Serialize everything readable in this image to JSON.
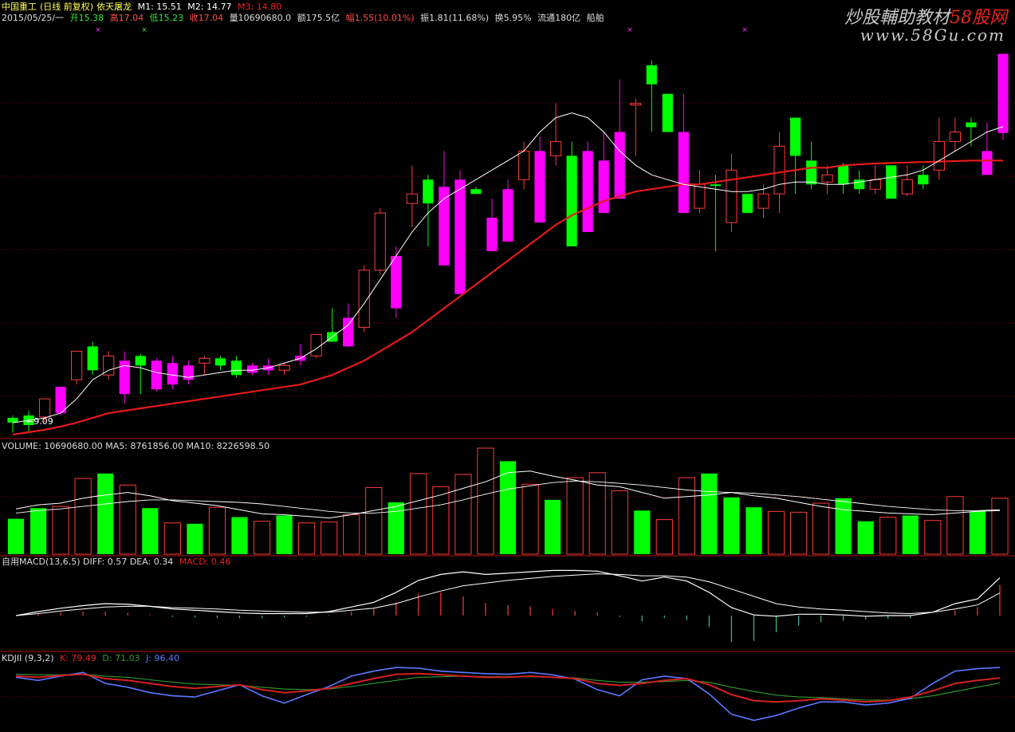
{
  "header": {
    "stock_name": "中国重工",
    "chart_mode": "(日线 前复权)",
    "indicator_name": "依天屠龙",
    "m1_label": "M1: 15.51",
    "m2_label": "M2: 14.77",
    "m3_label": "M3: 14.80",
    "date": "2015/05/25/一",
    "open": "开15.38",
    "high": "高17.04",
    "low": "低15.23",
    "close": "收17.04",
    "volume": "量10690680.0",
    "amount": "额175.5亿",
    "change": "幅1.55(10.01%)",
    "amplitude": "振1.81(11.68%)",
    "turnover": "换5.95%",
    "float_cap": "流通180亿",
    "sector": "船舶"
  },
  "watermark": {
    "line1_a": "炒股輔助教材",
    "line1_b": "58股网",
    "line2": "www.58Gu.com"
  },
  "panels": {
    "price_low_marker": "←9.09",
    "volume_header": "VOLUME: 10690680.00  MA5: 8761856.00  MA10: 8226598.50",
    "macd_header_a": "自用MACD(13,6,5)  DIFF: 0.57  DEA: 0.34",
    "macd_header_b": "MACD: 0.46",
    "kdj_header_a": "KDJII (9,3,2)",
    "kdj_header_b": "K: 79.49",
    "kdj_header_c": "D: 71.03",
    "kdj_header_d": "J: 96.40"
  },
  "colors": {
    "up": "#ff00ff",
    "down": "#00ff00",
    "hollow_up": "#ff3b3b",
    "ma_fast": "#ffffff",
    "ma_slow": "#e41a1a",
    "kdj_k": "#d42020",
    "kdj_d": "#2e9d2e",
    "kdj_j": "#5a78ff",
    "grid": "#7a0d0d"
  },
  "chart_data": {
    "type": "candlestick",
    "price": {
      "ylim": [
        9.0,
        17.5
      ],
      "candles": [
        {
          "o": 9.3,
          "h": 9.45,
          "l": 9.09,
          "c": 9.4,
          "style": "down"
        },
        {
          "o": 9.25,
          "h": 9.55,
          "l": 9.1,
          "c": 9.45,
          "style": "down"
        },
        {
          "o": 9.42,
          "h": 9.55,
          "l": 9.3,
          "c": 9.8,
          "style": "hollow"
        },
        {
          "o": 9.5,
          "h": 10.05,
          "l": 9.45,
          "c": 10.05,
          "style": "up"
        },
        {
          "o": 10.2,
          "h": 10.8,
          "l": 10.1,
          "c": 10.8,
          "style": "hollow"
        },
        {
          "o": 10.4,
          "h": 11.0,
          "l": 10.3,
          "c": 10.9,
          "style": "down"
        },
        {
          "o": 10.3,
          "h": 10.8,
          "l": 10.2,
          "c": 10.7,
          "style": "hollow"
        },
        {
          "o": 10.6,
          "h": 10.8,
          "l": 9.7,
          "c": 9.9,
          "style": "up"
        },
        {
          "o": 10.7,
          "h": 10.75,
          "l": 9.9,
          "c": 10.5,
          "style": "down"
        },
        {
          "o": 10.6,
          "h": 10.65,
          "l": 9.95,
          "c": 10.0,
          "style": "up"
        },
        {
          "o": 10.55,
          "h": 10.7,
          "l": 10.0,
          "c": 10.1,
          "style": "up"
        },
        {
          "o": 10.5,
          "h": 10.6,
          "l": 10.1,
          "c": 10.2,
          "style": "up"
        },
        {
          "o": 10.55,
          "h": 10.7,
          "l": 10.3,
          "c": 10.65,
          "style": "hollow"
        },
        {
          "o": 10.5,
          "h": 10.7,
          "l": 10.4,
          "c": 10.65,
          "style": "down"
        },
        {
          "o": 10.6,
          "h": 10.7,
          "l": 10.25,
          "c": 10.3,
          "style": "down"
        },
        {
          "o": 10.5,
          "h": 10.55,
          "l": 10.3,
          "c": 10.35,
          "style": "up"
        },
        {
          "o": 10.5,
          "h": 10.65,
          "l": 10.3,
          "c": 10.4,
          "style": "up"
        },
        {
          "o": 10.4,
          "h": 10.55,
          "l": 10.3,
          "c": 10.5,
          "style": "hollow"
        },
        {
          "o": 10.7,
          "h": 10.95,
          "l": 10.5,
          "c": 10.6,
          "style": "up"
        },
        {
          "o": 10.7,
          "h": 11.15,
          "l": 10.65,
          "c": 11.15,
          "style": "hollow"
        },
        {
          "o": 11.2,
          "h": 11.7,
          "l": 11.1,
          "c": 11.0,
          "style": "down"
        },
        {
          "o": 11.5,
          "h": 11.8,
          "l": 11.2,
          "c": 10.9,
          "style": "up"
        },
        {
          "o": 11.3,
          "h": 12.6,
          "l": 11.2,
          "c": 12.5,
          "style": "hollow"
        },
        {
          "o": 12.5,
          "h": 13.8,
          "l": 12.4,
          "c": 13.7,
          "style": "hollow"
        },
        {
          "o": 12.8,
          "h": 13.0,
          "l": 11.5,
          "c": 11.7,
          "style": "up"
        },
        {
          "o": 14.1,
          "h": 14.7,
          "l": 13.4,
          "c": 13.9,
          "style": "hollow"
        },
        {
          "o": 14.4,
          "h": 14.5,
          "l": 13.0,
          "c": 13.9,
          "style": "down"
        },
        {
          "o": 14.25,
          "h": 15.0,
          "l": 13.6,
          "c": 12.6,
          "style": "up"
        },
        {
          "o": 14.4,
          "h": 14.6,
          "l": 14.0,
          "c": 12.0,
          "style": "up"
        },
        {
          "o": 14.1,
          "h": 14.25,
          "l": 14.2,
          "c": 14.2,
          "style": "down"
        },
        {
          "o": 13.6,
          "h": 14.0,
          "l": 13.5,
          "c": 12.9,
          "style": "up"
        },
        {
          "o": 14.2,
          "h": 14.4,
          "l": 13.3,
          "c": 13.1,
          "style": "up"
        },
        {
          "o": 14.4,
          "h": 15.2,
          "l": 14.2,
          "c": 15.0,
          "style": "hollow"
        },
        {
          "o": 15.0,
          "h": 15.3,
          "l": 13.5,
          "c": 13.5,
          "style": "up"
        },
        {
          "o": 15.2,
          "h": 16.0,
          "l": 14.7,
          "c": 14.9,
          "style": "hollow"
        },
        {
          "o": 14.9,
          "h": 15.2,
          "l": 14.6,
          "c": 13.0,
          "style": "down"
        },
        {
          "o": 15.0,
          "h": 15.2,
          "l": 14.9,
          "c": 13.3,
          "style": "up"
        },
        {
          "o": 14.8,
          "h": 15.4,
          "l": 14.0,
          "c": 13.7,
          "style": "up"
        },
        {
          "o": 15.4,
          "h": 16.5,
          "l": 14.2,
          "c": 14.0,
          "style": "up"
        },
        {
          "o": 16.0,
          "h": 16.1,
          "l": 14.9,
          "c": 16.0,
          "style": "hollow"
        },
        {
          "o": 16.4,
          "h": 16.9,
          "l": 15.4,
          "c": 16.8,
          "style": "down"
        },
        {
          "o": 16.2,
          "h": 16.2,
          "l": 15.4,
          "c": 15.4,
          "style": "down"
        },
        {
          "o": 15.4,
          "h": 16.2,
          "l": 14.1,
          "c": 13.7,
          "style": "up"
        },
        {
          "o": 13.8,
          "h": 14.6,
          "l": 13.7,
          "c": 14.3,
          "style": "hollow"
        },
        {
          "o": 14.3,
          "h": 14.5,
          "l": 12.9,
          "c": 14.3,
          "style": "down"
        },
        {
          "o": 14.6,
          "h": 14.95,
          "l": 13.3,
          "c": 13.5,
          "style": "hollow"
        },
        {
          "o": 13.7,
          "h": 14.1,
          "l": 13.7,
          "c": 14.1,
          "style": "down"
        },
        {
          "o": 13.8,
          "h": 14.3,
          "l": 13.6,
          "c": 14.1,
          "style": "hollow"
        },
        {
          "o": 15.1,
          "h": 15.4,
          "l": 13.7,
          "c": 14.1,
          "style": "hollow"
        },
        {
          "o": 14.9,
          "h": 15.6,
          "l": 14.1,
          "c": 15.7,
          "style": "down"
        },
        {
          "o": 14.8,
          "h": 15.2,
          "l": 14.2,
          "c": 14.3,
          "style": "down"
        },
        {
          "o": 14.35,
          "h": 14.7,
          "l": 14.1,
          "c": 14.5,
          "style": "hollow"
        },
        {
          "o": 14.7,
          "h": 14.75,
          "l": 14.1,
          "c": 14.3,
          "style": "down"
        },
        {
          "o": 14.4,
          "h": 14.6,
          "l": 14.1,
          "c": 14.2,
          "style": "down"
        },
        {
          "o": 14.4,
          "h": 14.7,
          "l": 14.1,
          "c": 14.2,
          "style": "hollow"
        },
        {
          "o": 14.7,
          "h": 14.5,
          "l": 14.0,
          "c": 14.0,
          "style": "down"
        },
        {
          "o": 14.4,
          "h": 14.7,
          "l": 14.05,
          "c": 14.1,
          "style": "hollow"
        },
        {
          "o": 14.5,
          "h": 14.7,
          "l": 14.2,
          "c": 14.3,
          "style": "down"
        },
        {
          "o": 14.6,
          "h": 15.7,
          "l": 14.4,
          "c": 15.2,
          "style": "hollow"
        },
        {
          "o": 15.4,
          "h": 15.7,
          "l": 15.0,
          "c": 15.2,
          "style": "hollow"
        },
        {
          "o": 15.5,
          "h": 15.7,
          "l": 15.1,
          "c": 15.6,
          "style": "down"
        },
        {
          "o": 15.0,
          "h": 15.6,
          "l": 14.8,
          "c": 14.5,
          "style": "up"
        },
        {
          "o": 15.38,
          "h": 17.04,
          "l": 15.23,
          "c": 17.04,
          "style": "up"
        }
      ],
      "ma_fast": [
        9.3,
        9.35,
        9.4,
        9.5,
        9.8,
        10.2,
        10.4,
        10.5,
        10.45,
        10.35,
        10.3,
        10.25,
        10.3,
        10.35,
        10.4,
        10.4,
        10.45,
        10.55,
        10.65,
        10.85,
        11.1,
        11.35,
        11.8,
        12.3,
        12.8,
        13.3,
        13.7,
        14.0,
        14.2,
        14.4,
        14.6,
        14.8,
        15.0,
        15.4,
        15.7,
        15.8,
        15.7,
        15.4,
        15.0,
        14.7,
        14.5,
        14.4,
        14.3,
        14.25,
        14.2,
        14.15,
        14.15,
        14.2,
        14.3,
        14.35,
        14.35,
        14.3,
        14.3,
        14.35,
        14.4,
        14.45,
        14.5,
        14.6,
        14.8,
        15.0,
        15.2,
        15.4,
        15.51
      ],
      "ma_slow": [
        9.05,
        9.1,
        9.15,
        9.22,
        9.3,
        9.4,
        9.5,
        9.55,
        9.6,
        9.65,
        9.7,
        9.75,
        9.8,
        9.85,
        9.9,
        9.95,
        10.0,
        10.05,
        10.1,
        10.2,
        10.3,
        10.45,
        10.6,
        10.8,
        11.0,
        11.2,
        11.45,
        11.7,
        11.95,
        12.2,
        12.45,
        12.7,
        12.95,
        13.2,
        13.45,
        13.65,
        13.8,
        13.95,
        14.05,
        14.15,
        14.2,
        14.25,
        14.3,
        14.3,
        14.35,
        14.4,
        14.45,
        14.5,
        14.55,
        14.6,
        14.65,
        14.65,
        14.7,
        14.72,
        14.74,
        14.75,
        14.76,
        14.77,
        14.78,
        14.79,
        14.8,
        14.8,
        14.8
      ]
    },
    "volume": {
      "ylim": [
        0,
        12500000
      ],
      "bars": [
        {
          "v": 4300000,
          "style": "down"
        },
        {
          "v": 5600000,
          "style": "down"
        },
        {
          "v": 5800000,
          "style": "hollow"
        },
        {
          "v": 9200000,
          "style": "hollow"
        },
        {
          "v": 9800000,
          "style": "down"
        },
        {
          "v": 8400000,
          "style": "hollow"
        },
        {
          "v": 5600000,
          "style": "down"
        },
        {
          "v": 3800000,
          "style": "hollow"
        },
        {
          "v": 3700000,
          "style": "down"
        },
        {
          "v": 5700000,
          "style": "hollow"
        },
        {
          "v": 4500000,
          "style": "down"
        },
        {
          "v": 4000000,
          "style": "hollow"
        },
        {
          "v": 4700000,
          "style": "down"
        },
        {
          "v": 3800000,
          "style": "hollow"
        },
        {
          "v": 3900000,
          "style": "hollow"
        },
        {
          "v": 4800000,
          "style": "hollow"
        },
        {
          "v": 8100000,
          "style": "hollow"
        },
        {
          "v": 6300000,
          "style": "down"
        },
        {
          "v": 9800000,
          "style": "hollow"
        },
        {
          "v": 8200000,
          "style": "hollow"
        },
        {
          "v": 9700000,
          "style": "hollow"
        },
        {
          "v": 13200000,
          "style": "hollow"
        },
        {
          "v": 11300000,
          "style": "down"
        },
        {
          "v": 8500000,
          "style": "hollow"
        },
        {
          "v": 6600000,
          "style": "down"
        },
        {
          "v": 9300000,
          "style": "hollow"
        },
        {
          "v": 9900000,
          "style": "hollow"
        },
        {
          "v": 7700000,
          "style": "hollow"
        },
        {
          "v": 5300000,
          "style": "down"
        },
        {
          "v": 4200000,
          "style": "hollow"
        },
        {
          "v": 9300000,
          "style": "hollow"
        },
        {
          "v": 9800000,
          "style": "down"
        },
        {
          "v": 6900000,
          "style": "down"
        },
        {
          "v": 5700000,
          "style": "down"
        },
        {
          "v": 5200000,
          "style": "hollow"
        },
        {
          "v": 5100000,
          "style": "hollow"
        },
        {
          "v": 6200000,
          "style": "hollow"
        },
        {
          "v": 6800000,
          "style": "down"
        },
        {
          "v": 4000000,
          "style": "down"
        },
        {
          "v": 4500000,
          "style": "hollow"
        },
        {
          "v": 4700000,
          "style": "down"
        },
        {
          "v": 4100000,
          "style": "hollow"
        },
        {
          "v": 7000000,
          "style": "hollow"
        },
        {
          "v": 5200000,
          "style": "down"
        },
        {
          "v": 6800000,
          "style": "hollow"
        }
      ],
      "ma5": [
        5.5,
        6.0,
        6.2,
        6.8,
        7.2,
        7.5,
        7.1,
        6.5,
        6.2,
        5.9,
        5.4,
        4.9,
        4.8,
        4.6,
        4.4,
        4.8,
        5.3,
        5.8,
        6.5,
        7.2,
        8.0,
        8.8,
        9.9,
        10.1,
        9.5,
        9.0,
        8.4,
        8.2,
        7.5,
        6.8,
        7.0,
        7.2,
        7.5,
        7.1,
        6.8,
        6.3,
        5.8,
        5.4,
        5.2,
        5.0,
        4.9,
        4.8,
        5.0,
        5.2,
        5.3
      ],
      "ma10": [
        5.0,
        5.3,
        5.5,
        5.8,
        6.1,
        6.4,
        6.6,
        6.6,
        6.5,
        6.4,
        6.3,
        6.1,
        5.8,
        5.5,
        5.2,
        5.0,
        5.0,
        5.2,
        5.6,
        6.0,
        6.6,
        7.3,
        7.9,
        8.3,
        8.7,
        8.9,
        8.8,
        8.6,
        8.4,
        8.1,
        7.8,
        7.6,
        7.5,
        7.4,
        7.2,
        7.0,
        6.7,
        6.4,
        6.1,
        5.8,
        5.6,
        5.4,
        5.3,
        5.3,
        5.4
      ]
    },
    "macd": {
      "ylim": [
        -0.5,
        0.8
      ],
      "diff": [
        0.0,
        0.06,
        0.11,
        0.15,
        0.18,
        0.17,
        0.14,
        0.1,
        0.08,
        0.06,
        0.04,
        0.03,
        0.03,
        0.03,
        0.06,
        0.13,
        0.2,
        0.35,
        0.53,
        0.62,
        0.66,
        0.62,
        0.64,
        0.66,
        0.68,
        0.68,
        0.67,
        0.6,
        0.52,
        0.58,
        0.52,
        0.35,
        0.12,
        0.01,
        -0.01,
        0.02,
        0.02,
        0.01,
        -0.01,
        0.0,
        0.0,
        0.05,
        0.18,
        0.25,
        0.57
      ],
      "dea": [
        0.0,
        0.03,
        0.07,
        0.1,
        0.13,
        0.14,
        0.14,
        0.12,
        0.11,
        0.1,
        0.08,
        0.07,
        0.06,
        0.05,
        0.05,
        0.08,
        0.11,
        0.18,
        0.28,
        0.37,
        0.45,
        0.49,
        0.53,
        0.56,
        0.59,
        0.61,
        0.63,
        0.62,
        0.6,
        0.6,
        0.58,
        0.51,
        0.4,
        0.29,
        0.18,
        0.13,
        0.1,
        0.08,
        0.06,
        0.04,
        0.03,
        0.05,
        0.1,
        0.16,
        0.34
      ],
      "hist": [
        0.0,
        0.03,
        0.05,
        0.06,
        0.06,
        0.04,
        0.01,
        -0.02,
        -0.03,
        -0.04,
        -0.04,
        -0.04,
        -0.03,
        -0.02,
        0.01,
        0.06,
        0.11,
        0.2,
        0.33,
        0.35,
        0.29,
        0.19,
        0.16,
        0.14,
        0.1,
        0.07,
        0.05,
        -0.02,
        -0.09,
        -0.04,
        -0.07,
        -0.17,
        -0.4,
        -0.38,
        -0.25,
        -0.15,
        -0.1,
        -0.08,
        -0.06,
        -0.05,
        -0.04,
        0.0,
        0.08,
        0.13,
        0.46
      ]
    },
    "kdj": {
      "ylim": [
        -5,
        100
      ],
      "k": [
        82,
        80,
        83,
        85,
        78,
        75,
        70,
        65,
        62,
        65,
        68,
        60,
        55,
        58,
        62,
        70,
        78,
        85,
        86,
        84,
        82,
        80,
        80,
        82,
        80,
        78,
        70,
        67,
        70,
        75,
        78,
        68,
        52,
        42,
        40,
        42,
        45,
        43,
        40,
        42,
        48,
        58,
        70,
        75,
        79
      ],
      "d": [
        85,
        84,
        84,
        85,
        82,
        80,
        76,
        72,
        69,
        68,
        67,
        64,
        61,
        60,
        61,
        65,
        70,
        75,
        80,
        81,
        82,
        81,
        81,
        81,
        80,
        79,
        75,
        72,
        72,
        73,
        75,
        72,
        64,
        57,
        51,
        48,
        47,
        45,
        43,
        43,
        45,
        50,
        57,
        64,
        71
      ],
      "j": [
        80,
        75,
        82,
        88,
        70,
        64,
        55,
        50,
        48,
        58,
        68,
        50,
        38,
        52,
        65,
        82,
        90,
        96,
        95,
        90,
        88,
        86,
        85,
        88,
        84,
        77,
        60,
        50,
        76,
        82,
        78,
        53,
        20,
        10,
        18,
        30,
        40,
        40,
        35,
        38,
        46,
        70,
        90,
        94,
        96
      ]
    }
  }
}
